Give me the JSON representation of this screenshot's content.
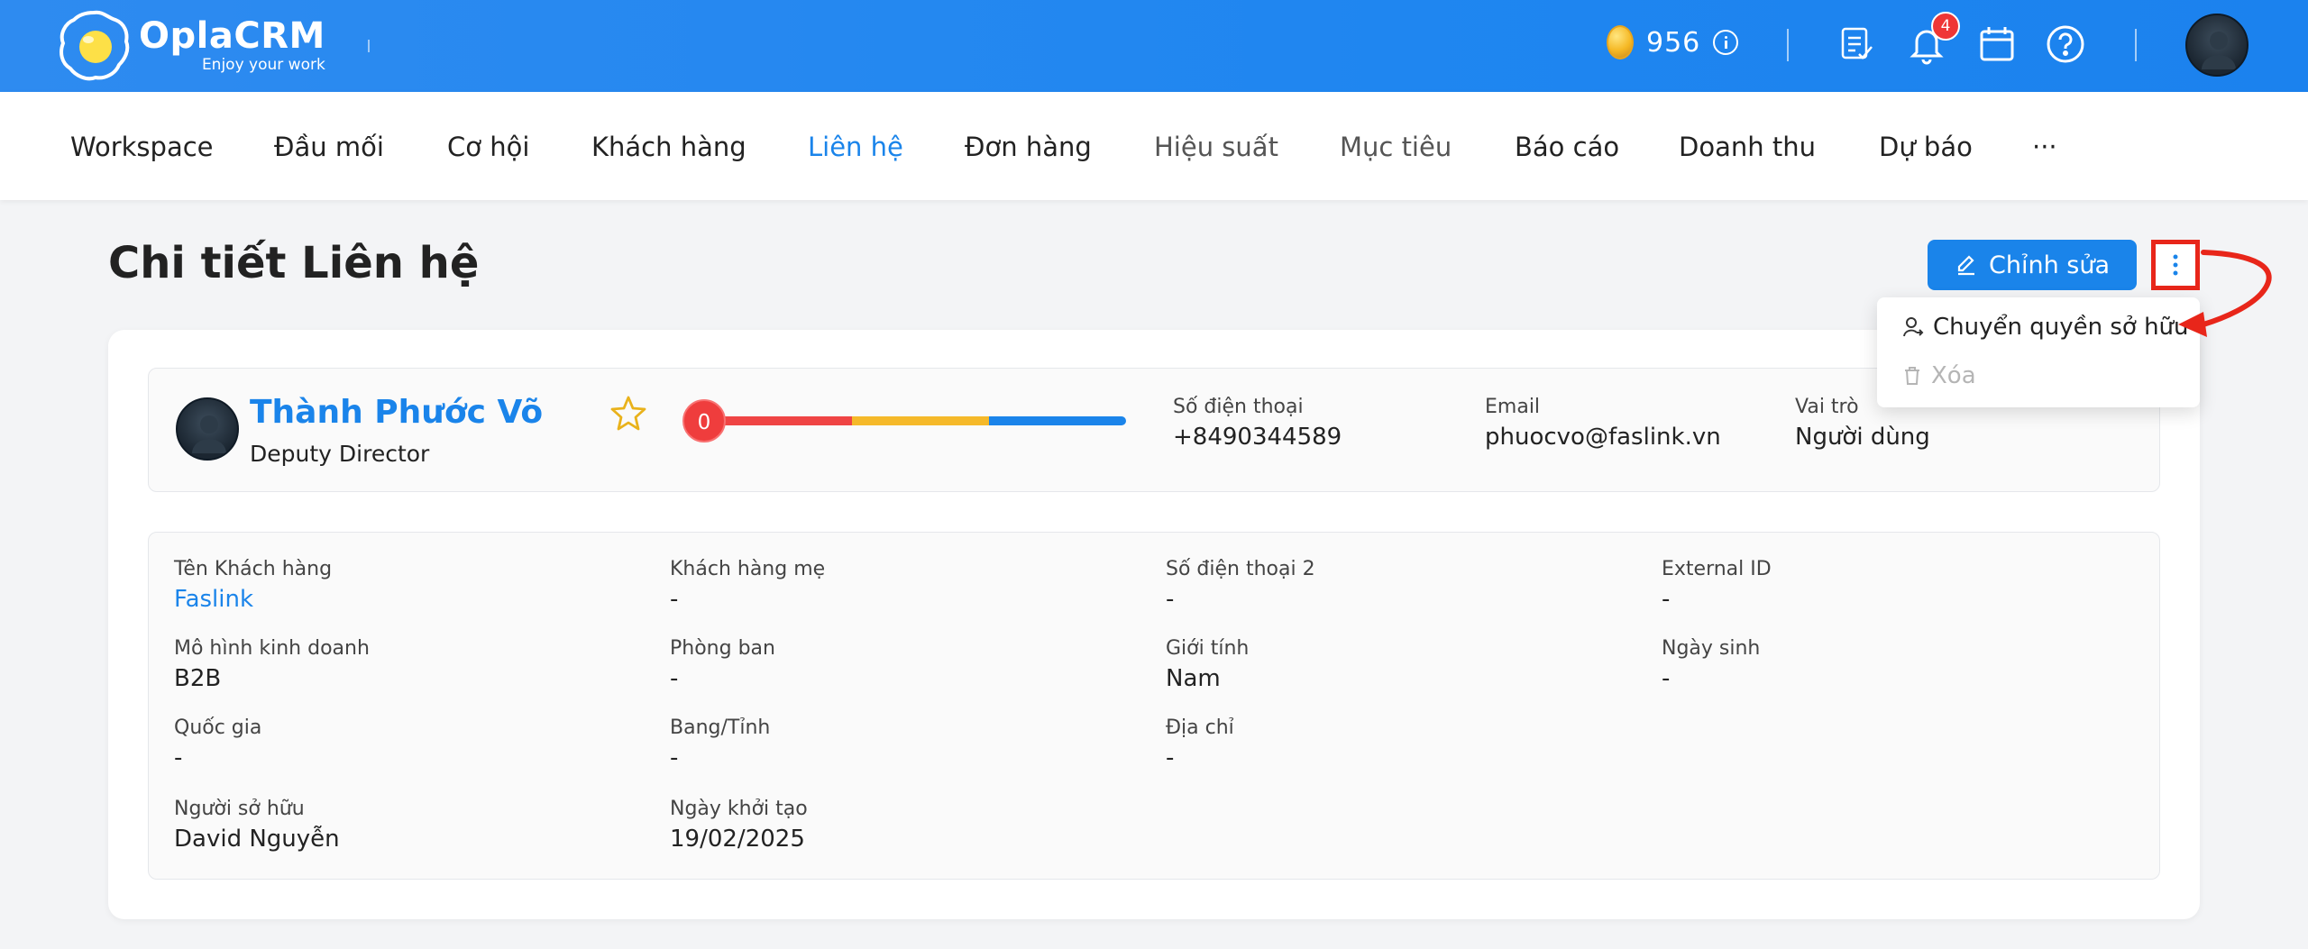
{
  "header": {
    "logo_title": "OplaCRM",
    "logo_subtitle": "Enjoy your work",
    "coins": "956",
    "notification_count": "4"
  },
  "nav": {
    "items": [
      {
        "label": "Workspace"
      },
      {
        "label": "Đầu mối"
      },
      {
        "label": "Cơ hội"
      },
      {
        "label": "Khách hàng"
      },
      {
        "label": "Liên hệ"
      },
      {
        "label": "Đơn hàng"
      },
      {
        "label": "Hiệu suất"
      },
      {
        "label": "Mục tiêu"
      },
      {
        "label": "Báo cáo"
      },
      {
        "label": "Doanh thu"
      },
      {
        "label": "Dự báo"
      },
      {
        "label": "···"
      }
    ],
    "active": "Liên hệ"
  },
  "page": {
    "title": "Chi tiết Liên hệ",
    "edit_label": "Chỉnh sửa"
  },
  "dropdown": {
    "transfer_label": "Chuyển quyền sở hữu",
    "delete_label": "Xóa"
  },
  "profile": {
    "name": "Thành Phước Võ",
    "role": "Deputy Director",
    "score": "0",
    "phone_label": "Số điện thoại",
    "phone_value": "+8490344589",
    "email_label": "Email",
    "email_value": "phuocvo@faslink.vn",
    "role_label": "Vai trò",
    "role_value": "Người dùng"
  },
  "details": {
    "customer_name_label": "Tên Khách hàng",
    "customer_name_value": "Faslink",
    "parent_customer_label": "Khách hàng mẹ",
    "parent_customer_value": "-",
    "phone2_label": "Số điện thoại 2",
    "phone2_value": "-",
    "external_id_label": "External ID",
    "external_id_value": "-",
    "business_model_label": "Mô hình kinh doanh",
    "business_model_value": "B2B",
    "department_label": "Phòng ban",
    "department_value": "-",
    "gender_label": "Giới tính",
    "gender_value": "Nam",
    "birthday_label": "Ngày sinh",
    "birthday_value": "-",
    "country_label": "Quốc gia",
    "country_value": "-",
    "state_label": "Bang/Tỉnh",
    "state_value": "-",
    "address_label": "Địa chỉ",
    "address_value": "-",
    "owner_label": "Người sở hữu",
    "owner_value": "David Nguyễn",
    "created_label": "Ngày khởi tạo",
    "created_value": "19/02/2025"
  },
  "colors": {
    "primary": "#1a84ea",
    "score_red": "#ef4444",
    "score_yellow": "#f5b92a",
    "score_blue": "#1a84ea",
    "annotation": "#e8261a"
  }
}
